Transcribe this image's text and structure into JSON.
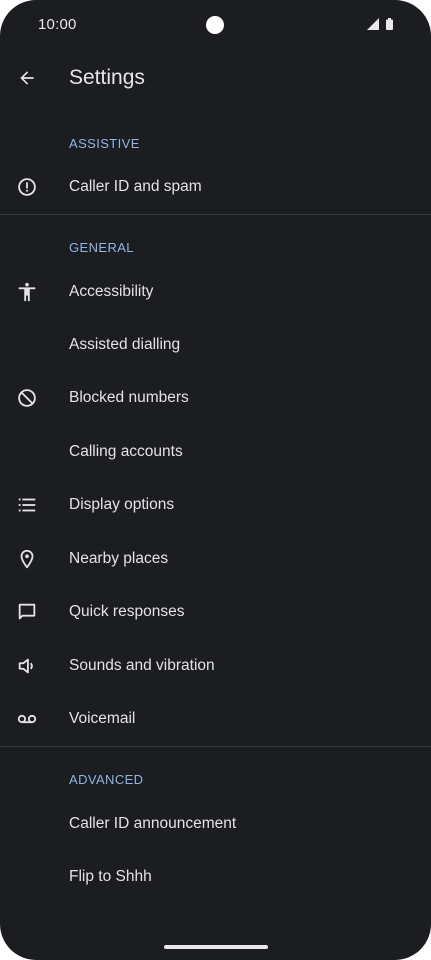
{
  "status_bar": {
    "time": "10:00",
    "icons": [
      "signal-icon",
      "battery-icon"
    ]
  },
  "app_bar": {
    "title": "Settings",
    "back_icon": "arrow-back-icon"
  },
  "sections": [
    {
      "header": "ASSISTIVE",
      "items": [
        {
          "label": "Caller ID and spam",
          "icon": "alert-circle-icon"
        }
      ]
    },
    {
      "header": "GENERAL",
      "items": [
        {
          "label": "Accessibility",
          "icon": "accessibility-icon"
        },
        {
          "label": "Assisted dialling",
          "icon": ""
        },
        {
          "label": "Blocked numbers",
          "icon": "block-icon"
        },
        {
          "label": "Calling accounts",
          "icon": ""
        },
        {
          "label": "Display options",
          "icon": "list-icon"
        },
        {
          "label": "Nearby places",
          "icon": "location-pin-icon"
        },
        {
          "label": "Quick responses",
          "icon": "chat-bubble-icon"
        },
        {
          "label": "Sounds and vibration",
          "icon": "volume-icon"
        },
        {
          "label": "Voicemail",
          "icon": "voicemail-icon"
        }
      ]
    },
    {
      "header": "ADVANCED",
      "items": [
        {
          "label": "Caller ID announcement",
          "icon": ""
        },
        {
          "label": "Flip to Shhh",
          "icon": ""
        }
      ]
    }
  ],
  "colors": {
    "background": "#1b1d20",
    "text": "#e3e3e6",
    "section_header": "#8fb5e5",
    "divider": "#34363a"
  }
}
